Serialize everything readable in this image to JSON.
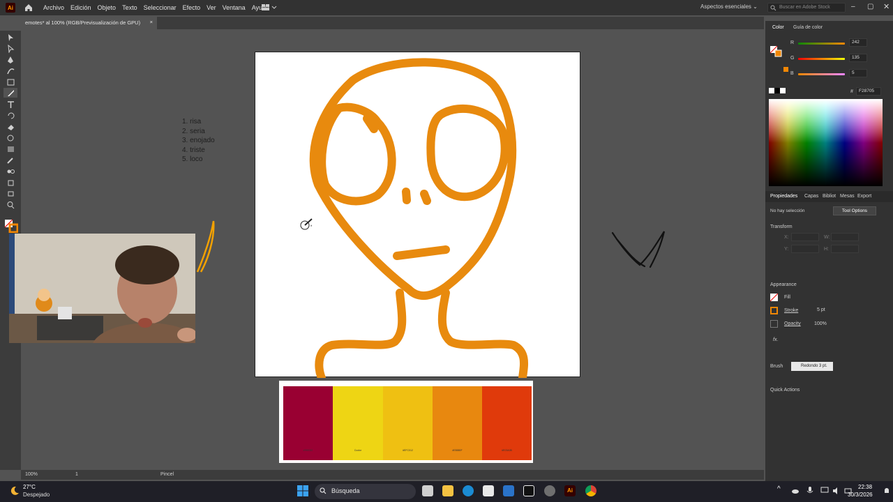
{
  "app": {
    "logo": "Ai",
    "menu": [
      "Archivo",
      "Edición",
      "Objeto",
      "Texto",
      "Seleccionar",
      "Efecto",
      "Ver",
      "Ventana",
      "Ayuda"
    ],
    "workspace": "Aspectos esenciales",
    "stock_search_placeholder": "Buscar en Adobe Stock"
  },
  "document_tab": {
    "title": "emotes* al 100% (RGB/Previsualización de GPU)",
    "close": "×"
  },
  "canvas": {
    "emote_list": [
      "1. risa",
      "2. seria",
      "3. enojado",
      "4. triste",
      "5. loco"
    ],
    "stroke_color": "#E88A0E",
    "palette": [
      {
        "color": "#990032",
        "label": "#990032"
      },
      {
        "color": "#EED514",
        "label": "Coolor"
      },
      {
        "color": "#EFC012",
        "label": "#EFC012"
      },
      {
        "color": "#E8880F",
        "label": "#E8880F"
      },
      {
        "color": "#E03A0B",
        "label": "#E03A0B"
      }
    ]
  },
  "status": {
    "zoom": "100%",
    "artboard": "1",
    "tool": "Pincel"
  },
  "color_panel": {
    "tabs": [
      "Color",
      "Guía de color"
    ],
    "r_label": "R",
    "g_label": "G",
    "b_label": "B",
    "r": "242",
    "g": "135",
    "b": "5",
    "hex_label": "#",
    "hex": "F28705"
  },
  "properties_panel": {
    "tabs": [
      "Propiedades",
      "Capas",
      "Bibliot",
      "Mesas",
      "Export"
    ],
    "no_selection": "No hay selección",
    "tool_options": "Tool Options",
    "transform": "Transform",
    "x_label": "X:",
    "y_label": "Y:",
    "w_label": "W:",
    "h_label": "H:",
    "appearance": "Appearance",
    "fill": "Fill",
    "stroke": "Stroke",
    "stroke_value": "5 pt",
    "opacity": "Opacity",
    "opacity_value": "100%",
    "fx": "fx.",
    "brush_label": "Brush",
    "brush_value": "Redondo 3 pt.",
    "quick_actions": "Quick Actions"
  },
  "taskbar": {
    "weather_temp": "27°C",
    "weather_desc": "Despejado",
    "search": "Búsqueda",
    "time": "22:38",
    "date": "30/3/2026"
  }
}
